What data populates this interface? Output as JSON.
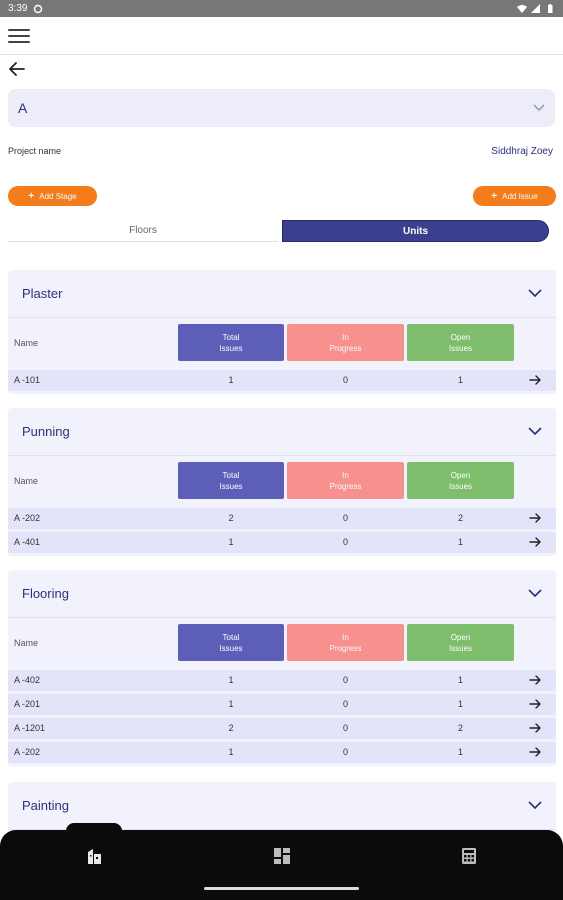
{
  "status_bar": {
    "time": "3:39"
  },
  "back_label": "back",
  "project": {
    "selected": "A",
    "label": "Project name",
    "owner": "Siddhraj Zoey"
  },
  "actions": {
    "add_stage": "Add Stage",
    "add_issue": "Add Issue"
  },
  "tabs": [
    {
      "label": "Floors"
    },
    {
      "label": "Units"
    }
  ],
  "table_headers": {
    "name": "Name",
    "total_line1": "Total",
    "total_line2": "Issues",
    "progress_line1": "In",
    "progress_line2": "Progress",
    "open_line1": "Open",
    "open_line2": "Issues"
  },
  "stages": [
    {
      "title": "Plaster",
      "units": [
        {
          "name": "A -101",
          "total": "1",
          "in_progress": "0",
          "open": "1"
        }
      ]
    },
    {
      "title": "Punning",
      "units": [
        {
          "name": "A -202",
          "total": "2",
          "in_progress": "0",
          "open": "2"
        },
        {
          "name": "A -401",
          "total": "1",
          "in_progress": "0",
          "open": "1"
        }
      ]
    },
    {
      "title": "Flooring",
      "units": [
        {
          "name": "A -402",
          "total": "1",
          "in_progress": "0",
          "open": "1"
        },
        {
          "name": "A -201",
          "total": "1",
          "in_progress": "0",
          "open": "1"
        },
        {
          "name": "A -1201",
          "total": "2",
          "in_progress": "0",
          "open": "2"
        },
        {
          "name": "A -202",
          "total": "1",
          "in_progress": "0",
          "open": "1"
        }
      ]
    },
    {
      "title": "Painting",
      "units": []
    }
  ],
  "icons": {
    "menu": "hamburger-menu-icon",
    "back": "arrow-left-icon",
    "expand": "chevron-down-icon",
    "row": "arrow-right-icon",
    "nav": [
      "building-icon",
      "dashboard-grid-icon",
      "calculator-icon"
    ]
  },
  "colors": {
    "primary": "#2a2f86",
    "accent": "#f57c1a",
    "total": "#5c5eb8",
    "in_progress": "#f8918e",
    "open": "#7dbd6b"
  }
}
